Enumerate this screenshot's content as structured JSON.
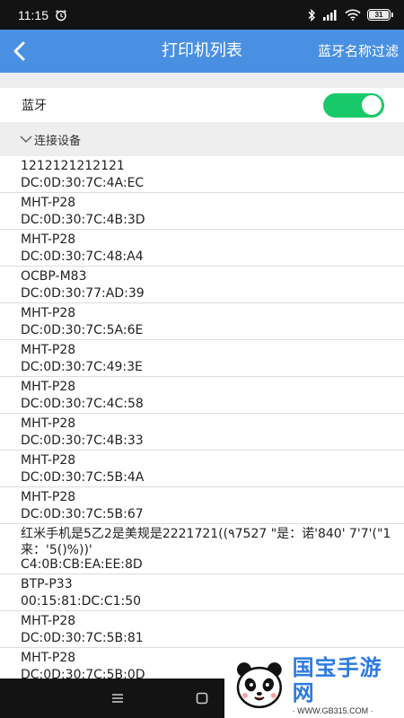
{
  "status_bar": {
    "time": "11:15",
    "battery": "31",
    "icons": [
      "alarm-icon",
      "bluetooth-icon",
      "signal-icon",
      "wifi-icon",
      "battery-icon"
    ]
  },
  "app_bar": {
    "title": "打印机列表",
    "filter_label": "蓝牙名称过滤",
    "color": "#4a90e2"
  },
  "bluetooth": {
    "label": "蓝牙",
    "enabled": true,
    "toggle_color": "#17c968"
  },
  "section": {
    "header": "连接设备"
  },
  "devices": [
    {
      "name": "1212121212121",
      "address": "DC:0D:30:7C:4A:EC"
    },
    {
      "name": "MHT-P28",
      "address": "DC:0D:30:7C:4B:3D"
    },
    {
      "name": "MHT-P28",
      "address": "DC:0D:30:7C:48:A4"
    },
    {
      "name": "OCBP-M83",
      "address": "DC:0D:30:77:AD:39"
    },
    {
      "name": "MHT-P28",
      "address": "DC:0D:30:7C:5A:6E"
    },
    {
      "name": "MHT-P28",
      "address": "DC:0D:30:7C:49:3E"
    },
    {
      "name": "MHT-P28",
      "address": "DC:0D:30:7C:4C:58"
    },
    {
      "name": "MHT-P28",
      "address": "DC:0D:30:7C:4B:33"
    },
    {
      "name": "MHT-P28",
      "address": "DC:0D:30:7C:5B:4A"
    },
    {
      "name": "MHT-P28",
      "address": "DC:0D:30:7C:5B:67"
    },
    {
      "name": "红米手机是5乙2是美规是2221721((٩7527 \"是：诺'840' 7'7'(\"1来：'5()%))'",
      "address": "C4:0B:CB:EA:EE:8D"
    },
    {
      "name": "BTP-P33",
      "address": "00:15:81:DC:C1:50"
    },
    {
      "name": "MHT-P28",
      "address": "DC:0D:30:7C:5B:81"
    },
    {
      "name": "MHT-P28",
      "address": "DC:0D:30:7C:5B:0D"
    }
  ],
  "nav_bar": {
    "buttons": [
      "menu-icon",
      "home-icon"
    ]
  },
  "watermark": {
    "brand": "国宝手游网",
    "url": "· WWW.GB315.COM ·"
  }
}
